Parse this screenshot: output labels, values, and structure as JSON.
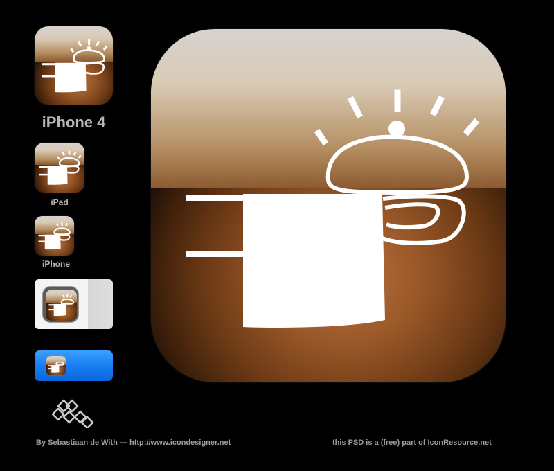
{
  "icon_labels": {
    "iphone4": "iPhone 4",
    "ipad": "iPad",
    "iphone": "iPhone"
  },
  "footer": {
    "left": "By Sebastiaan de With — http://www.icondesigner.net",
    "right": "this PSD is a (free) part of IconResource.net"
  },
  "colors": {
    "background": "#000000",
    "icon_orange": "#b8703c",
    "icon_top": "#d6d3cf",
    "blue_bar": "#1a7ef2",
    "label_gray": "#b5b5b5"
  },
  "icons": {
    "main_glyph": "cooking-pot-with-lid-icon",
    "logo": "knot-logo-icon"
  }
}
